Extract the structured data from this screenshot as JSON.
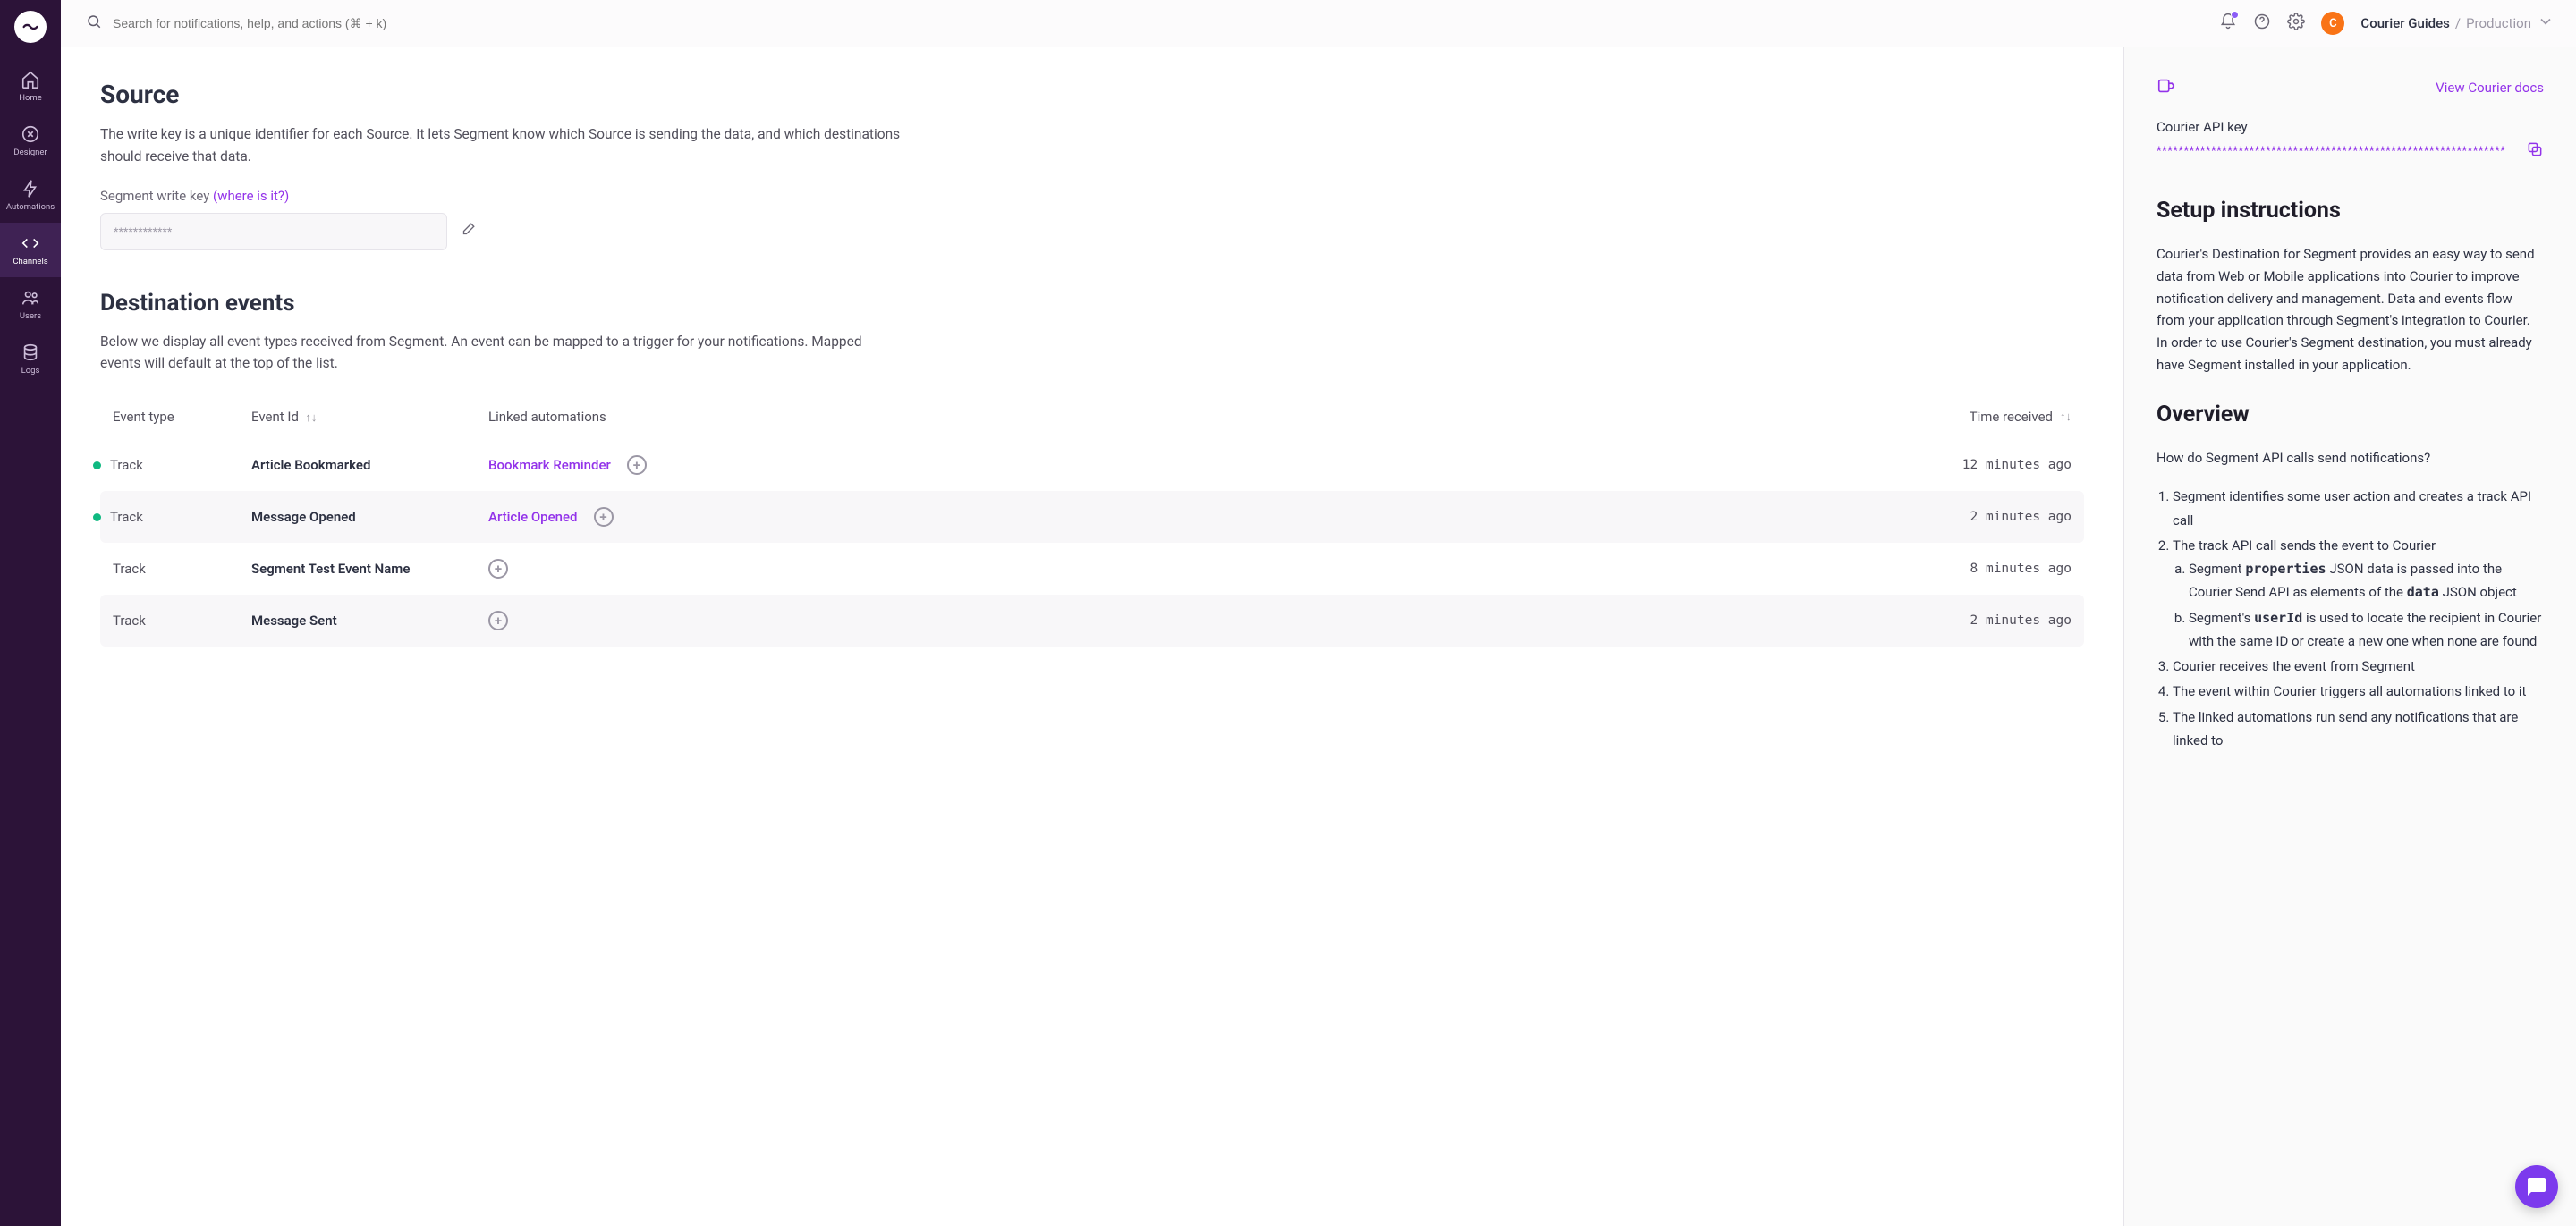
{
  "topbar": {
    "search_placeholder": "Search for notifications, help, and actions (⌘ + k)",
    "avatar_initial": "C",
    "workspace_name": "Courier Guides",
    "workspace_sep": " / ",
    "workspace_env": "Production"
  },
  "sidebar": {
    "items": [
      {
        "label": "Home"
      },
      {
        "label": "Designer"
      },
      {
        "label": "Automations"
      },
      {
        "label": "Channels"
      },
      {
        "label": "Users"
      },
      {
        "label": "Logs"
      }
    ]
  },
  "source": {
    "heading": "Source",
    "desc": "The write key is a unique identifier for each Source. It lets Segment know which Source is sending the data, and which destinations should receive that data.",
    "field_label": "Segment write key ",
    "where_link": "(where is it?)",
    "input_value": "************"
  },
  "events": {
    "heading": "Destination events",
    "desc": "Below we display all event types received from Segment. An event can be mapped to a trigger for your notifications. Mapped events will default at the top of the list.",
    "columns": {
      "type": "Event type",
      "id": "Event Id",
      "linked": "Linked automations",
      "time": "Time received"
    },
    "rows": [
      {
        "type": "Track",
        "id": "Article Bookmarked",
        "linked": "Bookmark Reminder",
        "time": "12 minutes ago",
        "dot": true
      },
      {
        "type": "Track",
        "id": "Message Opened",
        "linked": "Article Opened",
        "time": "2 minutes ago",
        "dot": true
      },
      {
        "type": "Track",
        "id": "Segment Test Event Name",
        "linked": "",
        "time": "8 minutes ago",
        "dot": false
      },
      {
        "type": "Track",
        "id": "Message Sent",
        "linked": "",
        "time": "2 minutes ago",
        "dot": false
      }
    ]
  },
  "right": {
    "docs_link": "View Courier docs",
    "api_label": "Courier API key",
    "api_key": "****************************************************************",
    "setup_heading": "Setup instructions",
    "setup_desc": "Courier's Destination for Segment provides an easy way to send data from Web or Mobile applications into Courier to improve notification delivery and management. Data and events flow from your application through Segment's integration to Courier. In order to use Courier's Segment destination, you must already have Segment installed in your application.",
    "overview_heading": "Overview",
    "overview_q": "How do Segment API calls send notifications?",
    "steps": {
      "s1": "Segment identifies some user action and creates a track API call",
      "s2": "The track API call sends the event to Courier",
      "s2a_pre": "Segment ",
      "s2a_code": "properties",
      "s2a_mid": " JSON data is passed into the Courier Send API as elements of the ",
      "s2a_code2": "data",
      "s2a_post": " JSON object",
      "s2b_pre": "Segment's ",
      "s2b_code": "userId",
      "s2b_post": " is used to locate the recipient in Courier with the same ID or create a new one when none are found",
      "s3": "Courier receives the event from Segment",
      "s4": "The event within Courier triggers all automations linked to it",
      "s5": "The linked automations run send any notifications that are linked to"
    }
  }
}
